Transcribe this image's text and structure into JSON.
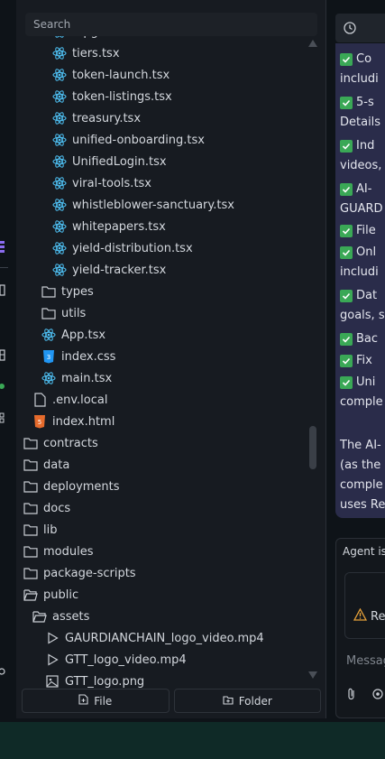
{
  "explorer": {
    "search_label": "Search",
    "partial_top": "...pg",
    "items": [
      {
        "name": "tiers.tsx",
        "type": "react"
      },
      {
        "name": "token-launch.tsx",
        "type": "react"
      },
      {
        "name": "token-listings.tsx",
        "type": "react"
      },
      {
        "name": "treasury.tsx",
        "type": "react"
      },
      {
        "name": "unified-onboarding.tsx",
        "type": "react"
      },
      {
        "name": "UnifiedLogin.tsx",
        "type": "react"
      },
      {
        "name": "viral-tools.tsx",
        "type": "react"
      },
      {
        "name": "whistleblower-sanctuary.tsx",
        "type": "react"
      },
      {
        "name": "whitepapers.tsx",
        "type": "react"
      },
      {
        "name": "yield-distribution.tsx",
        "type": "react"
      },
      {
        "name": "yield-tracker.tsx",
        "type": "react"
      },
      {
        "name": "types",
        "type": "folder"
      },
      {
        "name": "utils",
        "type": "folder"
      },
      {
        "name": "App.tsx",
        "type": "react"
      },
      {
        "name": "index.css",
        "type": "css"
      },
      {
        "name": "main.tsx",
        "type": "react"
      },
      {
        "name": ".env.local",
        "type": "file"
      },
      {
        "name": "index.html",
        "type": "html"
      },
      {
        "name": "contracts",
        "type": "folder"
      },
      {
        "name": "data",
        "type": "folder"
      },
      {
        "name": "deployments",
        "type": "folder"
      },
      {
        "name": "docs",
        "type": "folder"
      },
      {
        "name": "lib",
        "type": "folder"
      },
      {
        "name": "modules",
        "type": "folder"
      },
      {
        "name": "package-scripts",
        "type": "folder"
      },
      {
        "name": "public",
        "type": "folder-open"
      },
      {
        "name": "assets",
        "type": "folder-open"
      },
      {
        "name": "GAURDIANCHAIN_logo_video.mp4",
        "type": "video"
      },
      {
        "name": "GTT_logo_video.mp4",
        "type": "video"
      },
      {
        "name": "GTT_logo.png",
        "type": "image"
      }
    ],
    "new_file_label": "File",
    "new_folder_label": "Folder"
  },
  "chat": {
    "lines": [
      {
        "text": "Co",
        "check": true
      },
      {
        "text": "includi",
        "check": false
      },
      {
        "text": "5-s",
        "check": true
      },
      {
        "text": "Details",
        "check": false
      },
      {
        "text": "Ind",
        "check": true
      },
      {
        "text": "videos,",
        "check": false
      },
      {
        "text": "AI-",
        "check": true
      },
      {
        "text": "GUARD",
        "check": false
      },
      {
        "text": "File",
        "check": true
      },
      {
        "text": "Onl",
        "check": true
      },
      {
        "text": "includi",
        "check": false
      },
      {
        "text": "Dat",
        "check": true
      },
      {
        "text": "goals, s",
        "check": false
      },
      {
        "text": "Bac",
        "check": true
      },
      {
        "text": "Fix",
        "check": true
      },
      {
        "text": "Uni",
        "check": true
      },
      {
        "text": "comple",
        "check": false
      },
      {
        "text": "",
        "check": false
      },
      {
        "text": "The AI-",
        "check": false
      },
      {
        "text": "(as the",
        "check": false
      },
      {
        "text": "comple",
        "check": false
      },
      {
        "text": "uses Re",
        "check": false
      },
      {
        "text": "Ready",
        "check": false
      }
    ],
    "agent_label": "Agent is",
    "warning_text": "Re",
    "message_placeholder": "Messag"
  },
  "colors": {
    "react_icon": "#4fc3f7",
    "css_icon": "#2196f3",
    "html_icon": "#e66b2c",
    "check_green": "#3aa856",
    "chat_bubble": "#2a2c4a"
  }
}
